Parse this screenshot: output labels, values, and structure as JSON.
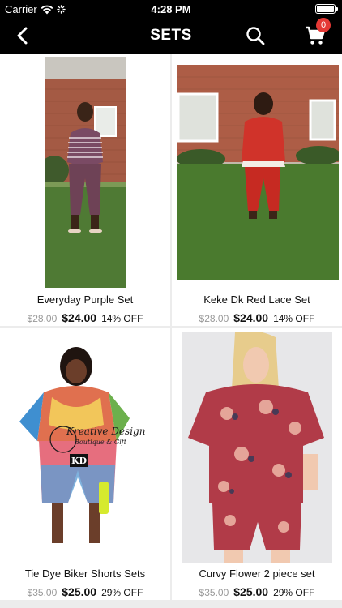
{
  "status_bar": {
    "carrier": "Carrier",
    "time": "4:28 PM",
    "battery_level": 1.0
  },
  "nav": {
    "title": "SETS",
    "cart_count": "0"
  },
  "products": [
    {
      "name": "Everyday Purple Set",
      "old_price": "$28.00",
      "price": "$24.00",
      "discount": "14% OFF"
    },
    {
      "name": "Keke Dk Red Lace Set",
      "old_price": "$28.00",
      "price": "$24.00",
      "discount": "14% OFF"
    },
    {
      "name": "Tie Dye Biker Shorts Sets",
      "old_price": "$35.00",
      "price": "$25.00",
      "discount": "29% OFF",
      "watermark": "Kreative Design Boutique & Gift KD"
    },
    {
      "name": "Curvy Flower 2 piece set",
      "old_price": "$35.00",
      "price": "$25.00",
      "discount": "29% OFF"
    }
  ],
  "colors": {
    "nav_bg": "#000000",
    "badge": "#e53935",
    "page_bg": "#ececec"
  }
}
